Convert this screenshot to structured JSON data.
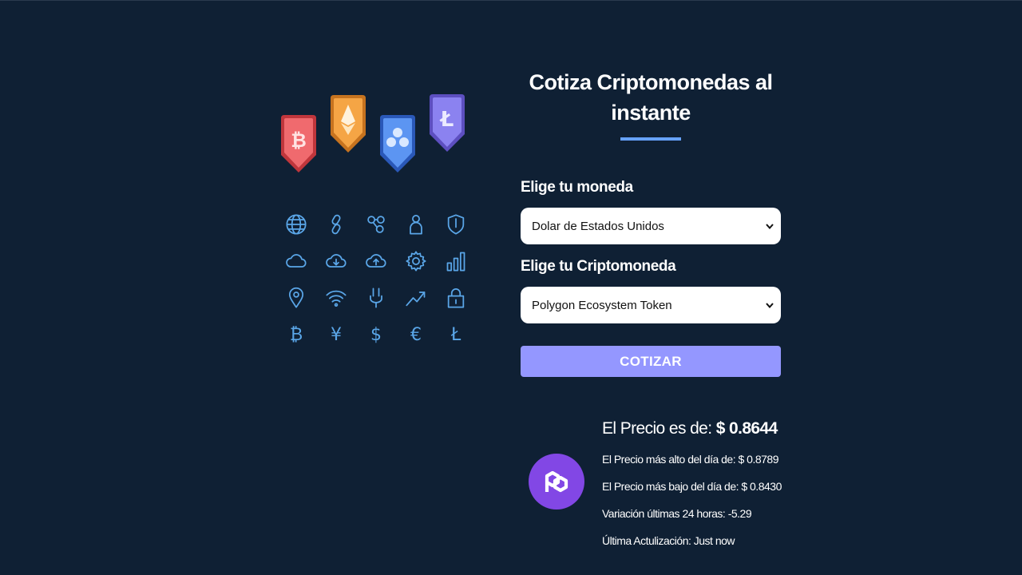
{
  "header": {
    "title": "Cotiza Criptomonedas al instante"
  },
  "form": {
    "currency_label": "Elige tu moneda",
    "currency_selected": "Dolar de Estados Unidos",
    "crypto_label": "Elige tu Criptomoneda",
    "crypto_selected": "Polygon Ecosystem Token",
    "submit_label": "COTIZAR"
  },
  "result": {
    "price_label": "El Precio es de: ",
    "price_value": "$ 0.8644",
    "high": "El Precio más alto del día de: $ 0.8789",
    "low": "El Precio más bajo del día de: $ 0.8430",
    "change": "Variación últimas 24 horas: -5.29",
    "updated": "Última Actulización: Just now"
  },
  "illustration": {
    "badges": [
      "bitcoin-badge-icon",
      "ethereum-badge-icon",
      "ripple-badge-icon",
      "litecoin-badge-icon"
    ],
    "icons": [
      "globe-icon",
      "chain-link-icon",
      "network-nodes-icon",
      "person-icon",
      "shield-icon",
      "cloud-icon",
      "cloud-download-icon",
      "cloud-upload-icon",
      "gear-icon",
      "bar-chart-icon",
      "location-pin-icon",
      "wifi-icon",
      "plug-icon",
      "trend-up-icon",
      "padlock-icon",
      "bitcoin-sign-icon",
      "yen-sign-icon",
      "dollar-sign-icon",
      "euro-sign-icon",
      "litecoin-sign-icon"
    ],
    "glyphs": {
      "bitcoin": "₿",
      "yen": "¥",
      "dollar": "$",
      "euro": "€",
      "litecoin": "Ł"
    }
  },
  "colors": {
    "background": "#0f2034",
    "accent": "#66a2fe",
    "button": "#9497ff",
    "polygon": "#8247e5"
  }
}
